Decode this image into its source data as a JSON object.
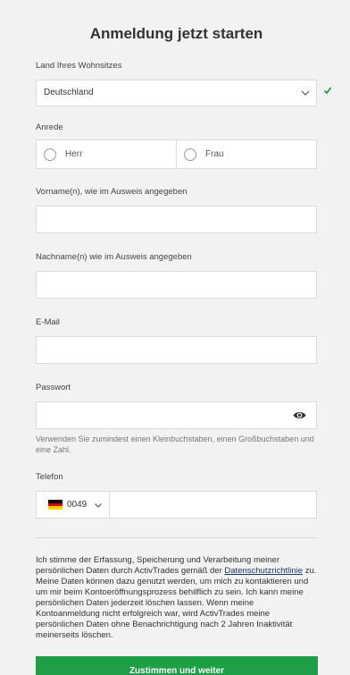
{
  "title": "Anmeldung jetzt starten",
  "colors": {
    "accent": "#1e9e45",
    "check": "#1e9e45",
    "link": "#1a3a6b",
    "background": "#f2f2f2"
  },
  "country": {
    "label": "Land Ihres Wohnsitzes",
    "value": "Deutschland",
    "icon": "chevron-down-icon",
    "valid_icon": "checkmark-icon"
  },
  "salutation": {
    "label": "Anrede",
    "options": [
      "Herr",
      "Frau"
    ]
  },
  "first_name": {
    "label": "Vorname(n), wie im Ausweis angegeben",
    "value": ""
  },
  "last_name": {
    "label": "Nachname(n) wie im Ausweis angegeben",
    "value": ""
  },
  "email": {
    "label": "E-Mail",
    "value": ""
  },
  "password": {
    "label": "Passwort",
    "value": "",
    "hint": "Verwenden Sie zumindest einen Kleinbuchstaben, einen Großbuchstaben und eine Zahl.",
    "icon": "eye-icon"
  },
  "phone": {
    "label": "Telefon",
    "country_code": "0049",
    "flag": "germany-flag-icon",
    "value": ""
  },
  "consent": {
    "text_before": "Ich stimme der Erfassung, Speicherung und Verarbeitung meiner persönlichen Daten durch ActivTrades gemäß der ",
    "link": "Datenschutzrichtlinie",
    "text_after": " zu. Meine Daten können dazu genutzt werden, um mich zu kontaktieren und um mir beim Kontoeröffnungsprozess behilflich zu sein. Ich kann meine persönlichen Daten jederzeit löschen lassen. Wenn meine Kontoanmeldung nicht erfolgreich war, wird ActivTrades meine persönlichen Daten ohne Benachrichtigung nach 2 Jahren Inaktivität meinerseits löschen."
  },
  "submit_label": "Zustimmen und weiter"
}
